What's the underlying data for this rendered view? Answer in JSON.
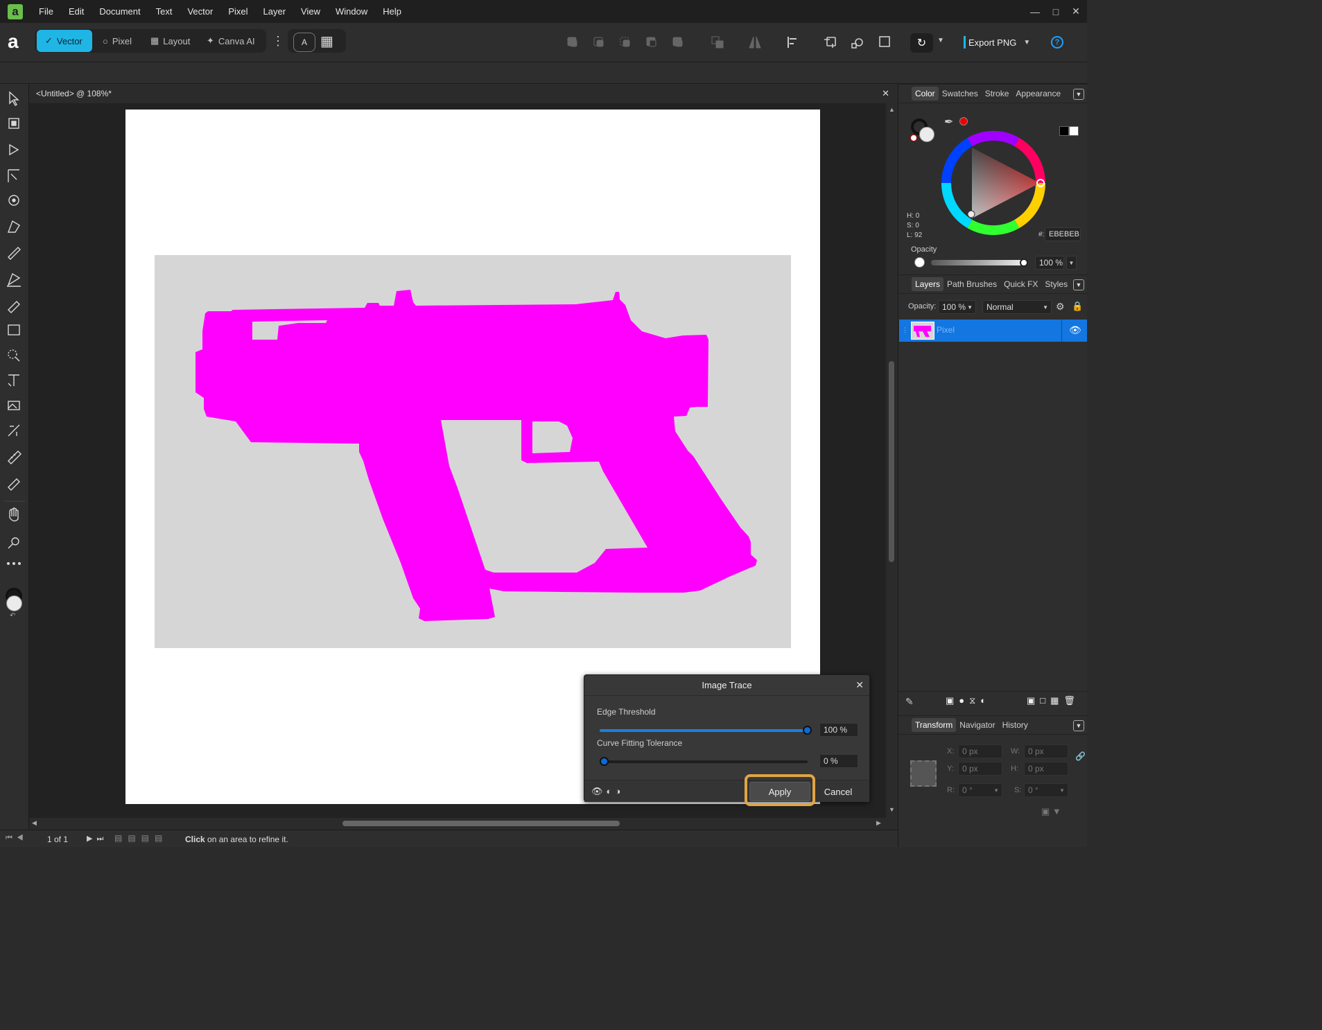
{
  "menu": {
    "items": [
      "File",
      "Edit",
      "Document",
      "Text",
      "Vector",
      "Pixel",
      "Layer",
      "View",
      "Window",
      "Help"
    ]
  },
  "toolbar": {
    "personas": [
      {
        "label": "Vector",
        "active": true
      },
      {
        "label": "Pixel",
        "active": false
      },
      {
        "label": "Layout",
        "active": false
      },
      {
        "label": "Canva AI",
        "active": false
      }
    ],
    "export_label": "Export PNG"
  },
  "document": {
    "tab_title": "<Untitled> @ 108%*",
    "content_color": "#ff00ff",
    "background_color": "#d6d6d6"
  },
  "status": {
    "page_label": "1 of 1",
    "hint_bold": "Click",
    "hint_text": "on an area to refine it."
  },
  "color_panel": {
    "tabs": [
      "Color",
      "Swatches",
      "Stroke",
      "Appearance"
    ],
    "active_tab": "Color",
    "h": "H: 0",
    "s": "S: 0",
    "l": "L: 92",
    "hex_label": "#:",
    "hex_value": "EBEBEB",
    "opacity_label": "Opacity",
    "opacity_value": "100 %"
  },
  "layers_panel": {
    "tabs": [
      "Layers",
      "Path Brushes",
      "Quick FX",
      "Styles"
    ],
    "active_tab": "Layers",
    "opacity_label": "Opacity:",
    "opacity_value": "100 %",
    "blend_mode": "Normal",
    "layers": [
      {
        "name": "Pixel",
        "selected": true,
        "visible": true
      }
    ]
  },
  "transform_panel": {
    "tabs": [
      "Transform",
      "Navigator",
      "History"
    ],
    "active_tab": "Transform",
    "x_label": "X:",
    "x_value": "0 px",
    "y_label": "Y:",
    "y_value": "0 px",
    "w_label": "W:",
    "w_value": "0 px",
    "h_label": "H:",
    "h_value": "0 px",
    "r_label": "R:",
    "r_value": "0 °",
    "s_label": "S:",
    "s_value": "0 °"
  },
  "image_trace": {
    "title": "Image Trace",
    "edge_label": "Edge Threshold",
    "edge_value": "100 %",
    "edge_level": 1.0,
    "curve_label": "Curve Fitting Tolerance",
    "curve_value": "0 %",
    "curve_level": 0.0,
    "apply_label": "Apply",
    "cancel_label": "Cancel"
  }
}
